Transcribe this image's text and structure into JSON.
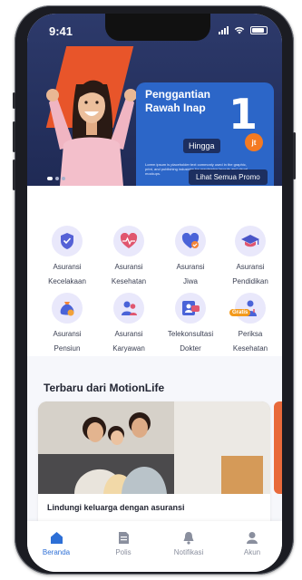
{
  "status_bar": {
    "time": "9:41"
  },
  "banner": {
    "title": "Penggantian Rawah Inap",
    "hingga": "Hingga",
    "amount": "1",
    "unit": "jt",
    "fine_print": "Lorem ipsum is placeholder text commonly used in the graphic, print, and publishing industries for previewing layouts and visual mockups.",
    "button": "Lihat Semua Promo",
    "colors": {
      "background": "#1f2a55",
      "card": "#2c66c8",
      "accent": "#e8552a"
    }
  },
  "services": [
    {
      "line1": "Asuransi",
      "line2": "Kecelakaan",
      "icon": "shield-icon"
    },
    {
      "line1": "Asuransi",
      "line2": "Kesehatan",
      "icon": "heart-pulse-icon"
    },
    {
      "line1": "Asuransi",
      "line2": "Jiwa",
      "icon": "heart-check-icon"
    },
    {
      "line1": "Asuransi",
      "line2": "Pendidikan",
      "icon": "graduation-cap-icon"
    },
    {
      "line1": "Asuransi",
      "line2": "Pensiun",
      "icon": "money-bag-icon"
    },
    {
      "line1": "Asuransi",
      "line2": "Karyawan",
      "icon": "people-icon"
    },
    {
      "line1": "Telekonsultasi",
      "line2": "Dokter",
      "icon": "chat-doctor-icon"
    },
    {
      "line1": "Periksa",
      "line2": "Kesehatan",
      "icon": "checkup-icon",
      "badge": "Gratis"
    }
  ],
  "news": {
    "section_title": "Terbaru dari MotionLife",
    "card_title": "Lindungi keluarga dengan asuransi"
  },
  "tabs": [
    {
      "label": "Beranda",
      "icon": "home-icon",
      "active": true
    },
    {
      "label": "Polis",
      "icon": "document-icon",
      "active": false
    },
    {
      "label": "Notifikasi",
      "icon": "bell-icon",
      "active": false
    },
    {
      "label": "Akun",
      "icon": "user-icon",
      "active": false
    }
  ],
  "accent_color": "#2d6fd6"
}
